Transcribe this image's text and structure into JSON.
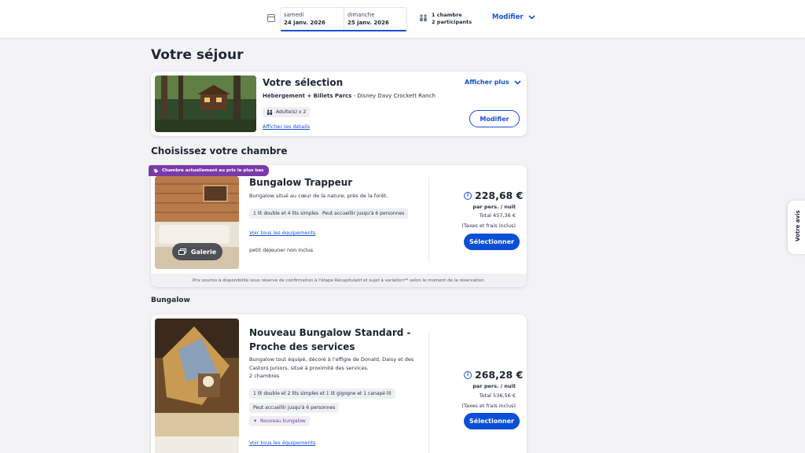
{
  "search_bar": {
    "checkin_day": "samedi",
    "checkin_date": "24 janv. 2026",
    "checkout_day": "dimanche",
    "checkout_date": "25 janv. 2026",
    "rooms": "1 chambre",
    "participants": "2 participants",
    "modify_label": "Modifier"
  },
  "page_title": "Votre séjour",
  "selection": {
    "title": "Votre sélection",
    "package_bold": "Hébergement + Billets Parcs",
    "package_rest": " - Disney Davy Crockett Ranch",
    "guests_chip": "Adulte(s) x 2",
    "details_link": "Afficher les détails",
    "show_more": "Afficher plus",
    "modify_button": "Modifier"
  },
  "choose_room_title": "Choisissez votre chambre",
  "featured_room": {
    "badge": "Chambre actuellement au prix le plus bas",
    "name": "Bungalow Trappeur",
    "description": "Bungalow situé au cœur de la nature, près de la forêt.",
    "features": [
      "1 lit double et 4 lits simples",
      "Peut accueillir jusqu'à 6 personnes"
    ],
    "equipment_link": "Voir tous les équipements",
    "breakfast": "petit déjeuner non inclus",
    "gallery_label": "Galerie",
    "price": "228,68 €",
    "price_unit": "par pers. / nuit",
    "total": "Total 457,36 €",
    "taxes": "(Taxes et frais inclus)",
    "select_label": "Sélectionner",
    "disclaimer": "Prix soumis à disponibilité sous réserve de confirmation à l'étape Récapitulatif et sujet à variation** selon le moment de la réservation."
  },
  "bungalow_section_title": "Bungalow",
  "standard_room": {
    "name_line1": "Nouveau Bungalow Standard -",
    "name_line2": "Proche des services",
    "desc_line1": "Bungalow tout équipé, décoré à l'effigie de Donald, Daisy et des",
    "desc_line2": "Castors Juniors, situé à proximité des services.",
    "desc_line3": "2 chambres",
    "features": [
      "1 lit double et 2 lits simples et 1 lit gigogne et 1 canapé lit",
      "Peut accueillir jusqu'à 6 personnes"
    ],
    "new_tag": "Nouveau bungalow",
    "equipment_link": "Voir tous les équipements",
    "price": "268,28 €",
    "price_unit": "par pers. / nuit",
    "total": "Total 536,56 €",
    "taxes": "(Taxes et frais inclus)",
    "select_label": "Sélectionner"
  },
  "side_tab": "Votre avis",
  "colors": {
    "primary": "#1551d6",
    "badge": "#7a3aa8"
  }
}
